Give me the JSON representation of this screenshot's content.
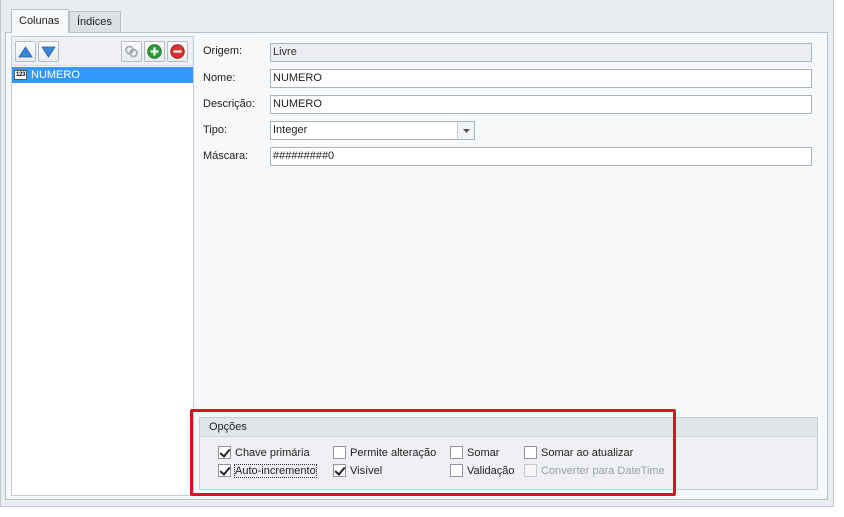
{
  "tabs": [
    {
      "label": "Colunas",
      "active": true
    },
    {
      "label": "Índices",
      "active": false
    }
  ],
  "toolbar": {
    "move_up_icon": "arrow-up-icon",
    "move_down_icon": "arrow-down-icon",
    "link_icon": "link-icon",
    "add_icon": "add-icon",
    "remove_icon": "remove-icon"
  },
  "columns_list": [
    {
      "type_badge": "123",
      "label": "NUMERO",
      "selected": true
    }
  ],
  "form": {
    "origem": {
      "label": "Origem:",
      "value": "Livre"
    },
    "nome": {
      "label": "Nome:",
      "value": "NUMERO"
    },
    "descricao": {
      "label": "Descrição:",
      "value": "NUMERO"
    },
    "tipo": {
      "label": "Tipo:",
      "value": "Integer"
    },
    "mascara": {
      "label": "Máscara:",
      "value": "#########0"
    }
  },
  "options": {
    "title": "Opções",
    "chave_primaria": {
      "label": "Chave primária",
      "checked": true
    },
    "auto_incremento": {
      "label": "Auto-incremento",
      "checked": true
    },
    "permite_alteracao": {
      "label": "Permite alteração",
      "checked": false
    },
    "visivel": {
      "label": "Visível",
      "checked": true
    },
    "somar": {
      "label": "Somar",
      "checked": false
    },
    "validacao": {
      "label": "Validação",
      "checked": false
    },
    "somar_ao_atualizar": {
      "label": "Somar ao atualizar",
      "checked": false
    },
    "converter_datetime": {
      "label": "Converter para DateTime",
      "checked": false,
      "disabled": true
    }
  },
  "colors": {
    "selection": "#3399ff",
    "highlight_border": "#e01020",
    "add_green": "#2e9b3a",
    "remove_red": "#d9312f",
    "arrow_blue": "#3a86d6"
  }
}
